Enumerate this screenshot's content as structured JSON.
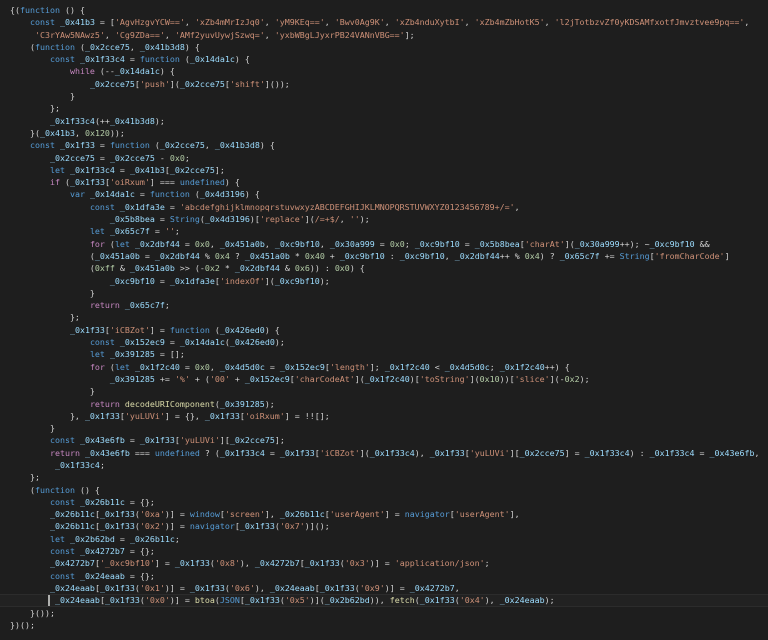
{
  "editor": {
    "theme_colors": {
      "background": "#1e1e1e",
      "text": "#d4d4d4",
      "string": "#ce9178",
      "keyword": "#569cd6",
      "control": "#c586c0",
      "identifier": "#9cdcfe",
      "number": "#b5cea8"
    },
    "cursor_line_index": 48,
    "lines": [
      "{(function () {",
      "    const _0x41b3 = ['AgvHzgvYCW==', 'xZb4mMrIzJq0', 'yM9KEq==', 'Bwv0Ag9K', 'xZb4nduXytbI', 'xZb4mZbHotK5', 'l2jTotbzvZf0yKDSAMfxotfJmvztvee9pq==',",
      "     'C3rYAw5NAwz5', 'Cg9ZDa==', 'AMf2yuvUywjSzwq=', 'yxbWBgLJyxrPB24VANnVBG=='];",
      "    (function (_0x2cce75, _0x41b3d8) {",
      "        const _0x1f33c4 = function (_0x14da1c) {",
      "            while (--_0x14da1c) {",
      "                _0x2cce75['push'](_0x2cce75['shift']());",
      "            }",
      "        };",
      "        _0x1f33c4(++_0x41b3d8);",
      "    }(_0x41b3, 0x120));",
      "    const _0x1f33 = function (_0x2cce75, _0x41b3d8) {",
      "        _0x2cce75 = _0x2cce75 - 0x0;",
      "        let _0x1f33c4 = _0x41b3[_0x2cce75];",
      "        if (_0x1f33['oiRxum'] === undefined) {",
      "            var _0x14da1c = function (_0x4d3196) {",
      "                const _0x1dfa3e = 'abcdefghijklmnopqrstuvwxyzABCDEFGHIJKLMNOPQRSTUVWXYZ0123456789+/=',",
      "                    _0x5b8bea = String(_0x4d3196)['replace'](/=+$/, '');",
      "                let _0x65c7f = '';",
      "                for (let _0x2dbf44 = 0x0, _0x451a0b, _0xc9bf10, _0x30a999 = 0x0; _0xc9bf10 = _0x5b8bea['charAt'](_0x30a999++); ~_0xc9bf10 &&",
      "                (_0x451a0b = _0x2dbf44 % 0x4 ? _0x451a0b * 0x40 + _0xc9bf10 : _0xc9bf10, _0x2dbf44++ % 0x4) ? _0x65c7f += String['fromCharCode']",
      "                (0xff & _0x451a0b >> (-0x2 * _0x2dbf44 & 0x6)) : 0x0) {",
      "                    _0xc9bf10 = _0x1dfa3e['indexOf'](_0xc9bf10);",
      "                }",
      "                return _0x65c7f;",
      "            };",
      "            _0x1f33['iCBZot'] = function (_0x426ed0) {",
      "                const _0x152ec9 = _0x14da1c(_0x426ed0);",
      "                let _0x391285 = [];",
      "                for (let _0x1f2c40 = 0x0, _0x4d5d0c = _0x152ec9['length']; _0x1f2c40 < _0x4d5d0c; _0x1f2c40++) {",
      "                    _0x391285 += '%' + ('00' + _0x152ec9['charCodeAt'](_0x1f2c40)['toString'](0x10))['slice'](-0x2);",
      "                }",
      "                return decodeURIComponent(_0x391285);",
      "            }, _0x1f33['yuLUVi'] = {}, _0x1f33['oiRxum'] = !![];",
      "        }",
      "        const _0x43e6fb = _0x1f33['yuLUVi'][_0x2cce75];",
      "        return _0x43e6fb === undefined ? (_0x1f33c4 = _0x1f33['iCBZot'](_0x1f33c4), _0x1f33['yuLUVi'][_0x2cce75] = _0x1f33c4) : _0x1f33c4 = _0x43e6fb,",
      "         _0x1f33c4;",
      "    };",
      "    (function () {",
      "        const _0x26b11c = {};",
      "        _0x26b11c[_0x1f33('0xa')] = window['screen'], _0x26b11c['userAgent'] = navigator['userAgent'],",
      "        _0x26b11c[_0x1f33('0x2')] = navigator[_0x1f33('0x7')]();",
      "        let _0x2b62bd = _0x26b11c;",
      "        const _0x4272b7 = {};",
      "        _0x4272b7['_0xc9bf10'] = _0x1f33('0x8'), _0x4272b7[_0x1f33('0x3')] = 'application/json';",
      "        const _0x24eaab = {};",
      "        _0x24eaab[_0x1f33('0x1')] = _0x1f33('0x6'), _0x24eaab[_0x1f33('0x9')] = _0x4272b7,",
      "         _0x24eaab[_0x1f33('0x0')] = btoa(JSON[_0x1f33('0x5')](_0x2b62bd)), fetch(_0x1f33('0x4'), _0x24eaab);",
      "    }());",
      "})();"
    ]
  }
}
